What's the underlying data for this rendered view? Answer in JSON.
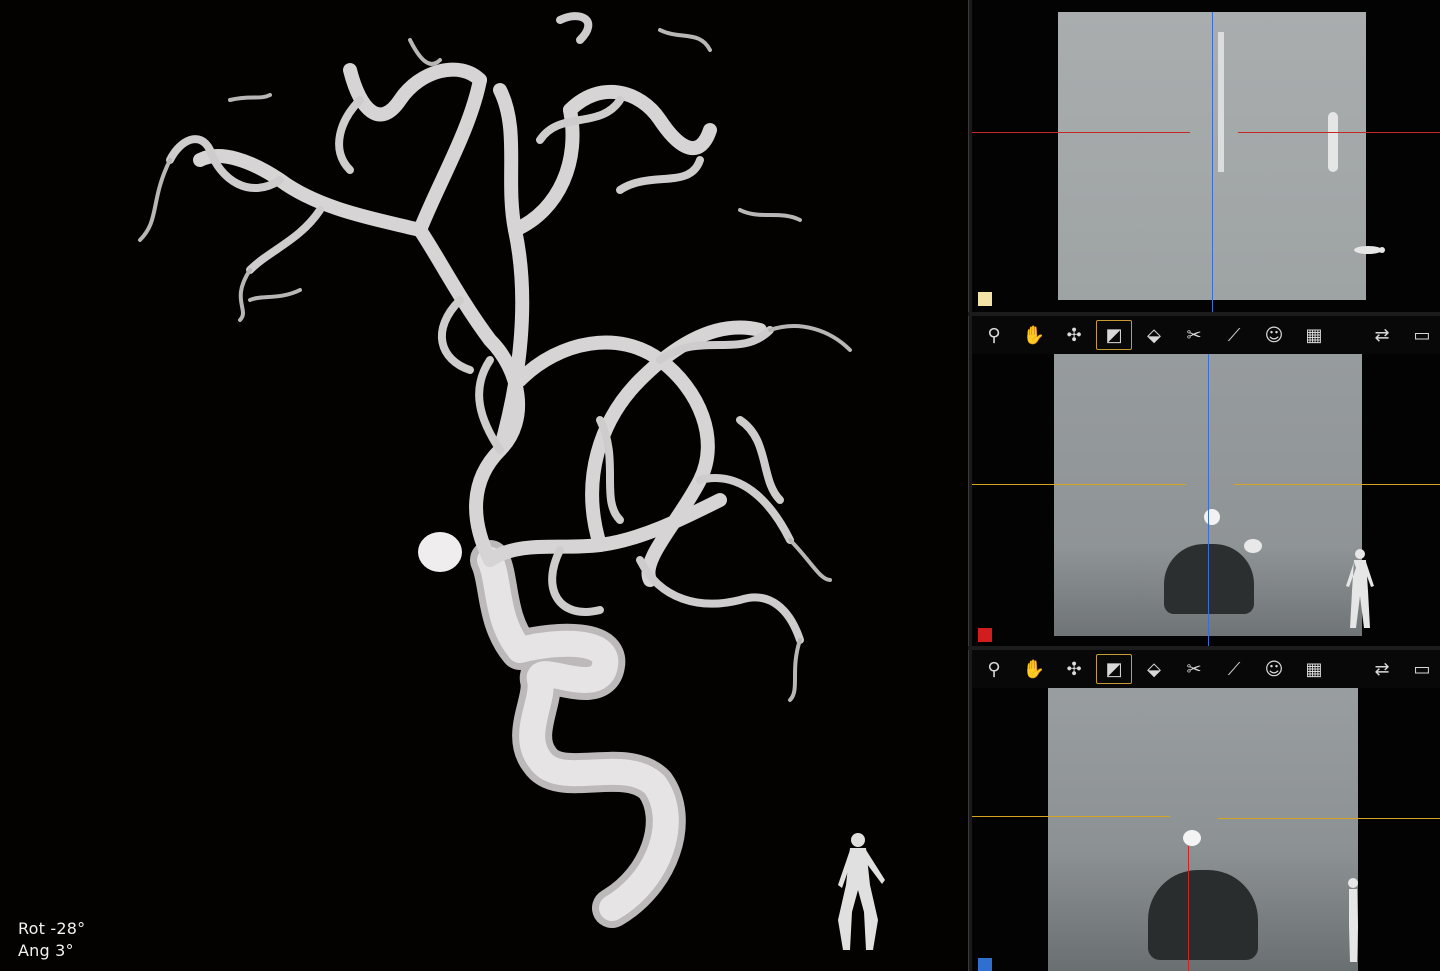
{
  "main_view": {
    "rotation_label": "Rot",
    "rotation_value": "-28°",
    "angle_label": "Ang",
    "angle_value": "3°"
  },
  "panels": [
    {
      "id": "axial-top",
      "marker_color": "#f3e2a6",
      "cross_h_color": "#c62828",
      "cross_v_color": "#3a6fd0"
    },
    {
      "id": "coronal-mid",
      "marker_color": "#d11d1d",
      "cross_h_color": "#d9a322",
      "cross_v_color": "#3a6fd0"
    },
    {
      "id": "sagittal-bottom",
      "marker_color": "#2f6fd0",
      "cross_h_color": "#d9a322",
      "cross_v_color": "#c62828"
    }
  ],
  "toolbar": {
    "tools": [
      {
        "name": "zoom-icon",
        "glyph": "⚲"
      },
      {
        "name": "pan-hand-icon",
        "glyph": "✋"
      },
      {
        "name": "rotate-icon",
        "glyph": "✣"
      },
      {
        "name": "window-level-icon",
        "glyph": "◩"
      },
      {
        "name": "slab-icon",
        "glyph": "⬙"
      },
      {
        "name": "scissors-icon",
        "glyph": "✂"
      },
      {
        "name": "measure-ruler-icon",
        "glyph": "⟋"
      },
      {
        "name": "head-orientation-icon",
        "glyph": "☺"
      },
      {
        "name": "color-map-icon",
        "glyph": "▦"
      }
    ],
    "right_tools": [
      {
        "name": "swap-view-icon",
        "glyph": "⇄"
      },
      {
        "name": "maximize-window-icon",
        "glyph": "▭"
      }
    ]
  },
  "colors": {
    "vessel": "#e4e2e3",
    "background": "#040201",
    "active_tool_border": "#c79a35"
  }
}
